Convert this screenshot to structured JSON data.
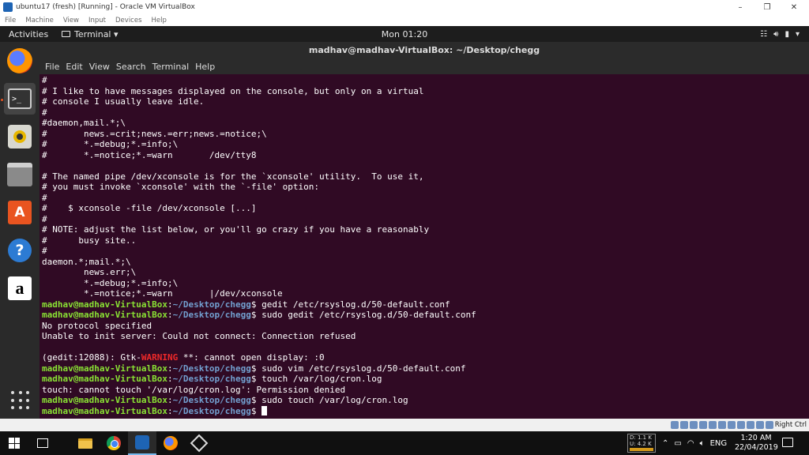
{
  "vbox": {
    "title": "ubuntu17 (fresh) [Running] - Oracle VM VirtualBox",
    "menu": [
      "File",
      "Machine",
      "View",
      "Input",
      "Devices",
      "Help"
    ],
    "host_key": "Right Ctrl"
  },
  "topbar": {
    "activities": "Activities",
    "app_menu": "Terminal ▾",
    "clock": "Mon 01:20"
  },
  "dock": {
    "icons": [
      "firefox-icon",
      "terminal-icon",
      "rhythmbox-icon",
      "files-icon",
      "software-icon",
      "help-icon",
      "amazon-icon",
      "show-apps-icon"
    ]
  },
  "terminal": {
    "title": "madhav@madhav-VirtualBox: ~/Desktop/chegg",
    "menu": [
      "File",
      "Edit",
      "View",
      "Search",
      "Terminal",
      "Help"
    ],
    "prompt_user": "madhav@madhav-VirtualBox",
    "prompt_sep": ":",
    "prompt_path": "~/Desktop/chegg",
    "prompt_end": "$ ",
    "lines": [
      {
        "t": "#"
      },
      {
        "t": "# I like to have messages displayed on the console, but only on a virtual"
      },
      {
        "t": "# console I usually leave idle."
      },
      {
        "t": "#"
      },
      {
        "t": "#daemon,mail.*;\\"
      },
      {
        "t": "#       news.=crit;news.=err;news.=notice;\\"
      },
      {
        "t": "#       *.=debug;*.=info;\\"
      },
      {
        "t": "#       *.=notice;*.=warn       /dev/tty8"
      },
      {
        "t": ""
      },
      {
        "t": "# The named pipe /dev/xconsole is for the `xconsole' utility.  To use it,"
      },
      {
        "t": "# you must invoke `xconsole' with the `-file' option:"
      },
      {
        "t": "#"
      },
      {
        "t": "#    $ xconsole -file /dev/xconsole [...]"
      },
      {
        "t": "#"
      },
      {
        "t": "# NOTE: adjust the list below, or you'll go crazy if you have a reasonably"
      },
      {
        "t": "#      busy site.."
      },
      {
        "t": "#"
      },
      {
        "t": "daemon.*;mail.*;\\"
      },
      {
        "t": "        news.err;\\"
      },
      {
        "t": "        *.=debug;*.=info;\\"
      },
      {
        "t": "        *.=notice;*.=warn       |/dev/xconsole"
      },
      {
        "p": true,
        "t": "gedit /etc/rsyslog.d/50-default.conf"
      },
      {
        "p": true,
        "t": "sudo gedit /etc/rsyslog.d/50-default.conf"
      },
      {
        "t": "No protocol specified"
      },
      {
        "t": "Unable to init server: Could not connect: Connection refused"
      },
      {
        "t": ""
      },
      {
        "w": true,
        "pre": "(gedit:12088): Gtk-",
        "warn": "WARNING",
        "post": " **: cannot open display: :0"
      },
      {
        "p": true,
        "t": "sudo vim /etc/rsyslog.d/50-default.conf"
      },
      {
        "p": true,
        "t": "touch /var/log/cron.log"
      },
      {
        "t": "touch: cannot touch '/var/log/cron.log': Permission denied"
      },
      {
        "p": true,
        "t": "sudo touch /var/log/cron.log"
      },
      {
        "p": true,
        "t": "",
        "cursor": true
      }
    ]
  },
  "taskbar": {
    "net_down": "D: 1.1 K",
    "net_up": "U: 4.2 K",
    "lang": "ENG",
    "time": "1:20 AM",
    "date": "22/04/2019"
  }
}
